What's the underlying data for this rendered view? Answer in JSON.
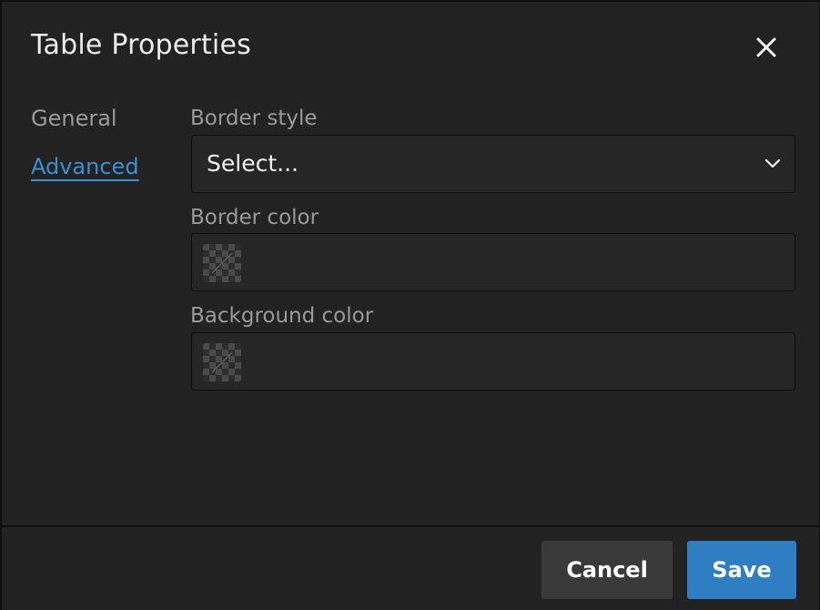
{
  "dialog": {
    "title": "Table Properties",
    "close_icon": "close-icon"
  },
  "tabs": [
    {
      "label": "General",
      "active": false
    },
    {
      "label": "Advanced",
      "active": true
    }
  ],
  "fields": {
    "border_style": {
      "label": "Border style",
      "value": "Select...",
      "icon": "chevron-down-icon"
    },
    "border_color": {
      "label": "Border color",
      "icon": "transparent-swatch-icon"
    },
    "background_color": {
      "label": "Background color",
      "icon": "transparent-swatch-icon"
    }
  },
  "footer": {
    "cancel_label": "Cancel",
    "save_label": "Save"
  },
  "colors": {
    "background": "#222222",
    "accent": "#2f7ec4",
    "link": "#3b8fd3",
    "cancel_button": "#3a3a3a"
  }
}
